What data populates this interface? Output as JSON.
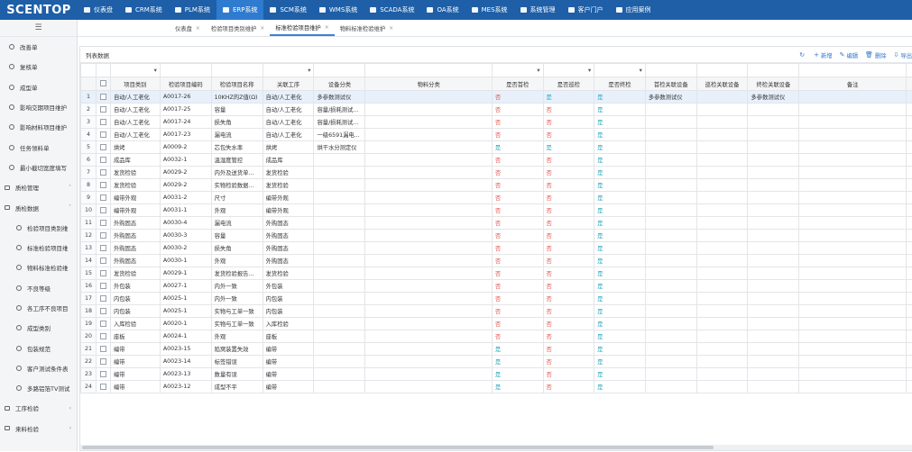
{
  "logo": "SCENTOP",
  "topnav": [
    "仪表盘",
    "CRM系统",
    "PLM系统",
    "ERP系统",
    "SCM系统",
    "WMS系统",
    "SCADA系统",
    "OA系统",
    "MES系统",
    "系统管理",
    "客户门户",
    "应用案例"
  ],
  "sidebar": {
    "toggle": "☰",
    "items": [
      {
        "label": "改善单",
        "level": 1
      },
      {
        "label": "复核单",
        "level": 1
      },
      {
        "label": "成型单",
        "level": 1
      },
      {
        "label": "影响交期项目维护",
        "level": 1
      },
      {
        "label": "影响材料项目维护",
        "level": 1
      },
      {
        "label": "任务领料单",
        "level": 1
      },
      {
        "label": "最小截切宽度填写",
        "level": 1
      },
      {
        "label": "质检管理",
        "level": 0,
        "arrow": "˅"
      },
      {
        "label": "质检数据",
        "level": 0,
        "arrow": "˅"
      },
      {
        "label": "检验项目类别维",
        "level": 2
      },
      {
        "label": "标准检验项目维",
        "level": 2
      },
      {
        "label": "物料标准检验维",
        "level": 2
      },
      {
        "label": "不良等级",
        "level": 2
      },
      {
        "label": "各工序不良项目",
        "level": 2
      },
      {
        "label": "成型类别",
        "level": 2
      },
      {
        "label": "包装规范",
        "level": 2
      },
      {
        "label": "客户测试条件表",
        "level": 2
      },
      {
        "label": "多路铝箔TV测试",
        "level": 2
      },
      {
        "label": "工序检验",
        "level": 0,
        "arrow": "‹"
      },
      {
        "label": "来料检验",
        "level": 0,
        "arrow": "‹"
      }
    ]
  },
  "tabs": [
    {
      "label": "仪表盘",
      "active": false
    },
    {
      "label": "检验项目类别维护",
      "active": false
    },
    {
      "label": "标准检验项目维护",
      "active": true
    },
    {
      "label": "物料标准检验维护",
      "active": false
    }
  ],
  "panel": {
    "title": "列表数据"
  },
  "toolbar": [
    {
      "glyph": "↻",
      "label": ""
    },
    {
      "glyph": "+",
      "label": "新增"
    },
    {
      "glyph": "✎",
      "label": "编辑"
    },
    {
      "glyph": "🗑",
      "label": "删除"
    },
    {
      "glyph": "⇩",
      "label": "导出"
    }
  ],
  "columns": [
    "项目类别",
    "检验项目编码",
    "检验项目名称",
    "关联工序",
    "设备分类",
    "物料分类",
    "是否首检",
    "是否巡检",
    "是否终检",
    "首检关联设备",
    "巡检关联设备",
    "终检关联设备",
    "备注"
  ],
  "rows": [
    [
      "自动/人工老化",
      "A0017-26",
      "10KHZ的Z值(Ω)",
      "自动/人工老化",
      "多参数测试仪",
      "",
      "否",
      "是",
      "是",
      "多参数测试仪",
      "",
      "多参数测试仪",
      ""
    ],
    [
      "自动/人工老化",
      "A0017-25",
      "容量",
      "自动/人工老化",
      "容量/损耗测试...",
      "",
      "否",
      "否",
      "是",
      "",
      "",
      "",
      ""
    ],
    [
      "自动/人工老化",
      "A0017-24",
      "损失角",
      "自动/人工老化",
      "容量/损耗测试...",
      "",
      "否",
      "否",
      "是",
      "",
      "",
      "",
      ""
    ],
    [
      "自动/人工老化",
      "A0017-23",
      "漏电流",
      "自动/人工老化",
      "一级6591漏电...",
      "",
      "否",
      "否",
      "是",
      "",
      "",
      "",
      ""
    ],
    [
      "烘烤",
      "A0009-2",
      "芯包失水率",
      "烘烤",
      "烘干水分测定仪",
      "",
      "是",
      "是",
      "是",
      "",
      "",
      "",
      ""
    ],
    [
      "成品库",
      "A0032-1",
      "温湿度管控",
      "成品库",
      "",
      "",
      "否",
      "否",
      "是",
      "",
      "",
      "",
      ""
    ],
    [
      "发货检验",
      "A0029-2",
      "内外及送货单...",
      "发货检验",
      "",
      "",
      "否",
      "否",
      "是",
      "",
      "",
      "",
      ""
    ],
    [
      "发货检验",
      "A0029-2",
      "实物检验数据...",
      "发货检验",
      "",
      "",
      "否",
      "否",
      "是",
      "",
      "",
      "",
      ""
    ],
    [
      "编带外观",
      "A0031-2",
      "尺寸",
      "编带外观",
      "",
      "",
      "否",
      "否",
      "是",
      "",
      "",
      "",
      ""
    ],
    [
      "编带外观",
      "A0031-1",
      "外观",
      "编带外观",
      "",
      "",
      "否",
      "否",
      "是",
      "",
      "",
      "",
      ""
    ],
    [
      "外购固态",
      "A0030-4",
      "漏电流",
      "外购固态",
      "",
      "",
      "否",
      "否",
      "是",
      "",
      "",
      "",
      ""
    ],
    [
      "外购固态",
      "A0030-3",
      "容量",
      "外购固态",
      "",
      "",
      "否",
      "否",
      "是",
      "",
      "",
      "",
      ""
    ],
    [
      "外购固态",
      "A0030-2",
      "损失角",
      "外购固态",
      "",
      "",
      "否",
      "否",
      "是",
      "",
      "",
      "",
      ""
    ],
    [
      "外购固态",
      "A0030-1",
      "外观",
      "外购固态",
      "",
      "",
      "否",
      "否",
      "是",
      "",
      "",
      "",
      ""
    ],
    [
      "发货检验",
      "A0029-1",
      "发货检验报告...",
      "发货检验",
      "",
      "",
      "否",
      "否",
      "是",
      "",
      "",
      "",
      ""
    ],
    [
      "外包装",
      "A0027-1",
      "内外一致",
      "外包装",
      "",
      "",
      "否",
      "否",
      "是",
      "",
      "",
      "",
      ""
    ],
    [
      "内包装",
      "A0025-1",
      "内外一致",
      "内包装",
      "",
      "",
      "否",
      "否",
      "是",
      "",
      "",
      "",
      ""
    ],
    [
      "内包装",
      "A0025-1",
      "实物与工单一致",
      "内包装",
      "",
      "",
      "否",
      "否",
      "是",
      "",
      "",
      "",
      ""
    ],
    [
      "入库检验",
      "A0020-1",
      "实物与工单一致",
      "入库检验",
      "",
      "",
      "否",
      "否",
      "是",
      "",
      "",
      "",
      ""
    ],
    [
      "座板",
      "A0024-1",
      "外观",
      "座板",
      "",
      "",
      "否",
      "否",
      "是",
      "",
      "",
      "",
      ""
    ],
    [
      "编带",
      "A0023-15",
      "陷窝装置失效",
      "编带",
      "",
      "",
      "是",
      "否",
      "是",
      "",
      "",
      "",
      ""
    ],
    [
      "编带",
      "A0023-14",
      "标签错误",
      "编带",
      "",
      "",
      "是",
      "否",
      "是",
      "",
      "",
      "",
      ""
    ],
    [
      "编带",
      "A0023-13",
      "数量有误",
      "编带",
      "",
      "",
      "是",
      "否",
      "是",
      "",
      "",
      "",
      ""
    ],
    [
      "编带",
      "A0023-12",
      "成型不平",
      "编带",
      "",
      "",
      "是",
      "否",
      "是",
      "",
      "",
      "",
      ""
    ]
  ]
}
